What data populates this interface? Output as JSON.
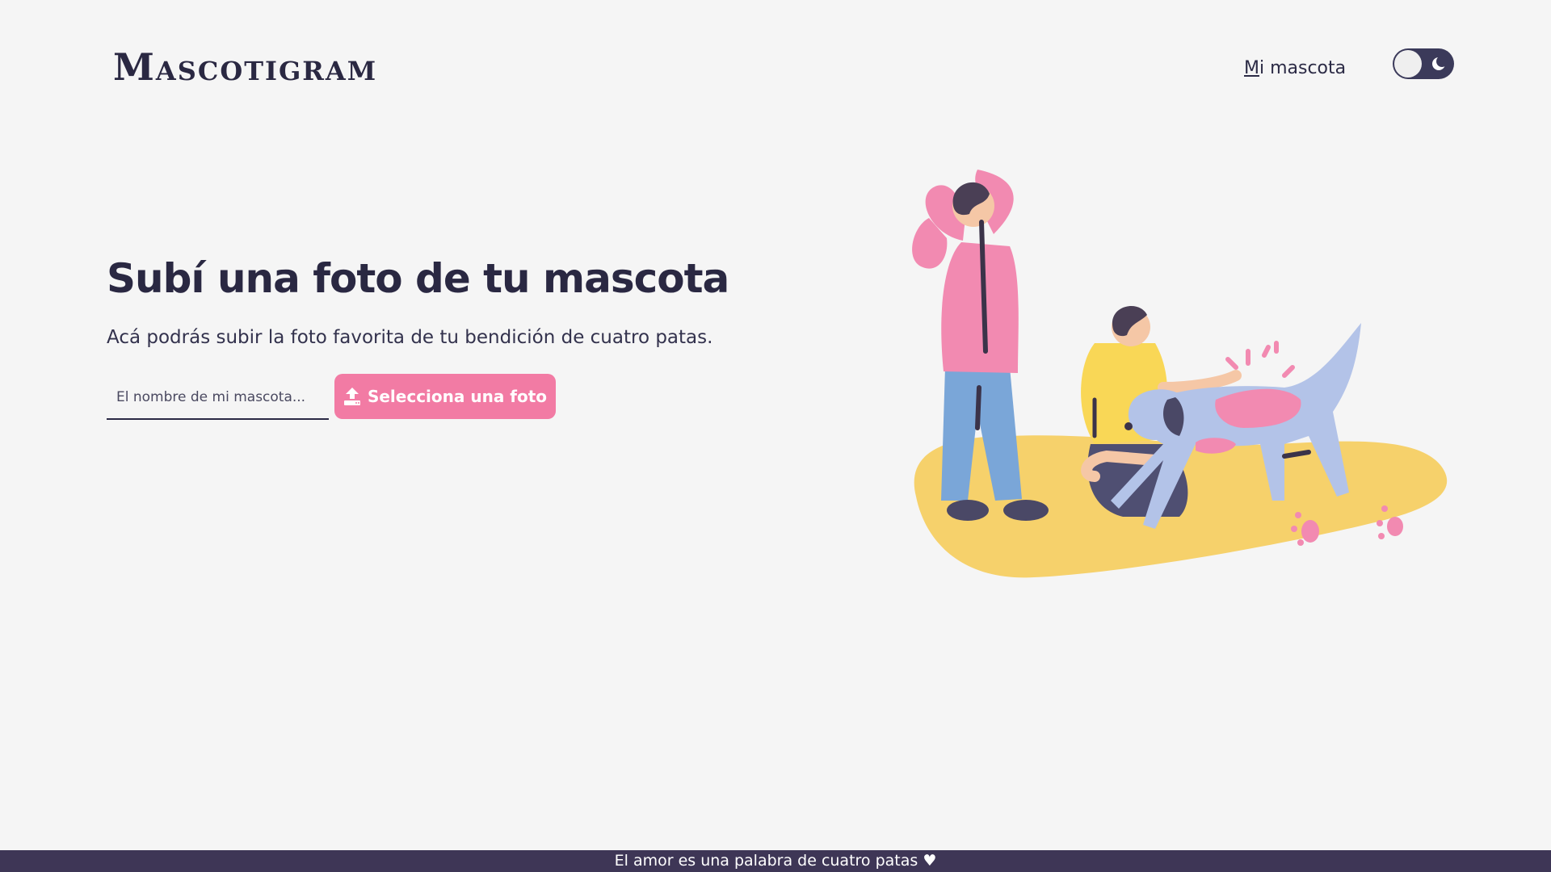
{
  "header": {
    "logo": "Mascotigram",
    "nav_link_first": "M",
    "nav_link_rest": "i mascota",
    "theme_toggle_icon": "moon-icon"
  },
  "hero": {
    "title": "Subí una foto de tu mascota",
    "subtitle": "Acá podrás subir la foto favorita de tu bendición de cuatro patas.",
    "name_input_placeholder": "El nombre de mi mascota...",
    "upload_button_label": "Selecciona una foto",
    "upload_icon": "upload-icon"
  },
  "footer": {
    "text": "El amor es una palabra de cuatro patas ♥"
  },
  "colors": {
    "background": "#f5f5f5",
    "accent_pink": "#f27ba4",
    "dark_navy": "#2b2a45",
    "footer_bg": "#3e3656",
    "illustration_yellow": "#f6d16b",
    "illustration_blue": "#7aa6d8",
    "illustration_dog": "#b3c3e8"
  }
}
